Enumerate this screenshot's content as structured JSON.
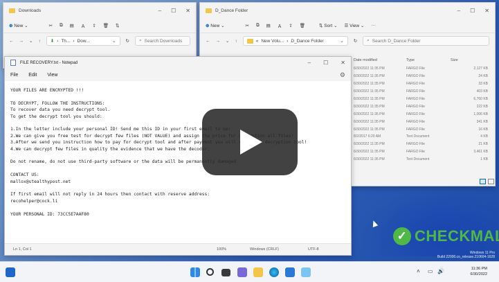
{
  "downloads_window": {
    "title": "Downloads",
    "new_label": "New",
    "path_parts": [
      "Th...",
      "Dow..."
    ],
    "search_placeholder": "Search Downloads"
  },
  "dance_window": {
    "title": "D_Dance Folder",
    "new_label": "New",
    "sort_label": "Sort",
    "view_label": "View",
    "path_parts": [
      "New Volu...",
      "D_Dance Folder"
    ],
    "search_placeholder": "Search D_Dance Folder",
    "columns": [
      "Date modified",
      "Type",
      "Size"
    ],
    "rows": [
      {
        "date": "6/30/2022 11:35 PM",
        "type": "FARGO File",
        "size": "2,127 KB"
      },
      {
        "date": "6/30/2022 11:35 PM",
        "type": "FARGO File",
        "size": "24 KB"
      },
      {
        "date": "6/30/2022 11:35 PM",
        "type": "FARGO File",
        "size": "33 KB"
      },
      {
        "date": "6/30/2022 11:35 PM",
        "type": "FARGO File",
        "size": "403 KB"
      },
      {
        "date": "6/30/2022 11:35 PM",
        "type": "FARGO File",
        "size": "6,760 KB"
      },
      {
        "date": "6/30/2022 11:35 PM",
        "type": "FARGO File",
        "size": "222 KB"
      },
      {
        "date": "6/30/2022 11:35 PM",
        "type": "FARGO File",
        "size": "1,006 KB"
      },
      {
        "date": "6/30/2022 11:35 PM",
        "type": "FARGO File",
        "size": "341 KB"
      },
      {
        "date": "6/30/2022 11:35 PM",
        "type": "FARGO File",
        "size": "16 KB"
      },
      {
        "date": "8/2/2017 6:20 AM",
        "type": "Text Document",
        "size": "4 KB"
      },
      {
        "date": "6/30/2022 11:35 PM",
        "type": "FARGO File",
        "size": "21 KB"
      },
      {
        "date": "6/30/2022 11:35 PM",
        "type": "FARGO File",
        "size": "3,461 KB"
      },
      {
        "date": "6/30/2022 11:35 PM",
        "type": "Text Document",
        "size": "1 KB"
      }
    ]
  },
  "notepad": {
    "title": "FILE RECOVERY.txt - Notepad",
    "menu": [
      "File",
      "Edit",
      "View"
    ],
    "lines": [
      "YOUR FILES ARE ENCRYPTED !!!",
      "",
      "TO DECRYPT, FOLLOW THE INSTRUCTIONS:",
      "To recover data you need decrypt tool.",
      "To get the decrypt tool you should:",
      "",
      "1.In the letter include your personal ID! Send me this ID in your first email to me!",
      "2.We can give you free test for decrypt few files (NOT VALUE) and assign the price for decryption all files!",
      "3.After we send you instruction how to pay for decrypt tool and after payment you will receive a decryption tool!",
      "4.We can decrypt few files in quality the evidence that we have the decoder.",
      "",
      "Do not rename, do not use third-party software or the data will be permanently damaged",
      "",
      "CONTACT US:",
      "mallox@stealthypost.net",
      "",
      "If first email will not reply in 24 hours then contact with reserve address:",
      "recohelper@cock.li",
      "",
      "YOUR PERSONAL ID: 73CC5E7AAF80"
    ],
    "status": {
      "position": "Ln 1, Col 1",
      "zoom": "100%",
      "eol": "Windows (CRLF)",
      "encoding": "UTF-8"
    }
  },
  "desktop": {
    "watermark": "CHECKMAL",
    "os_line1": "Windows 11 Pro",
    "os_line2": "Build 22000.co_release.210604-1628"
  },
  "taskbar": {
    "time": "11:36 PM",
    "date": "6/30/2022"
  }
}
